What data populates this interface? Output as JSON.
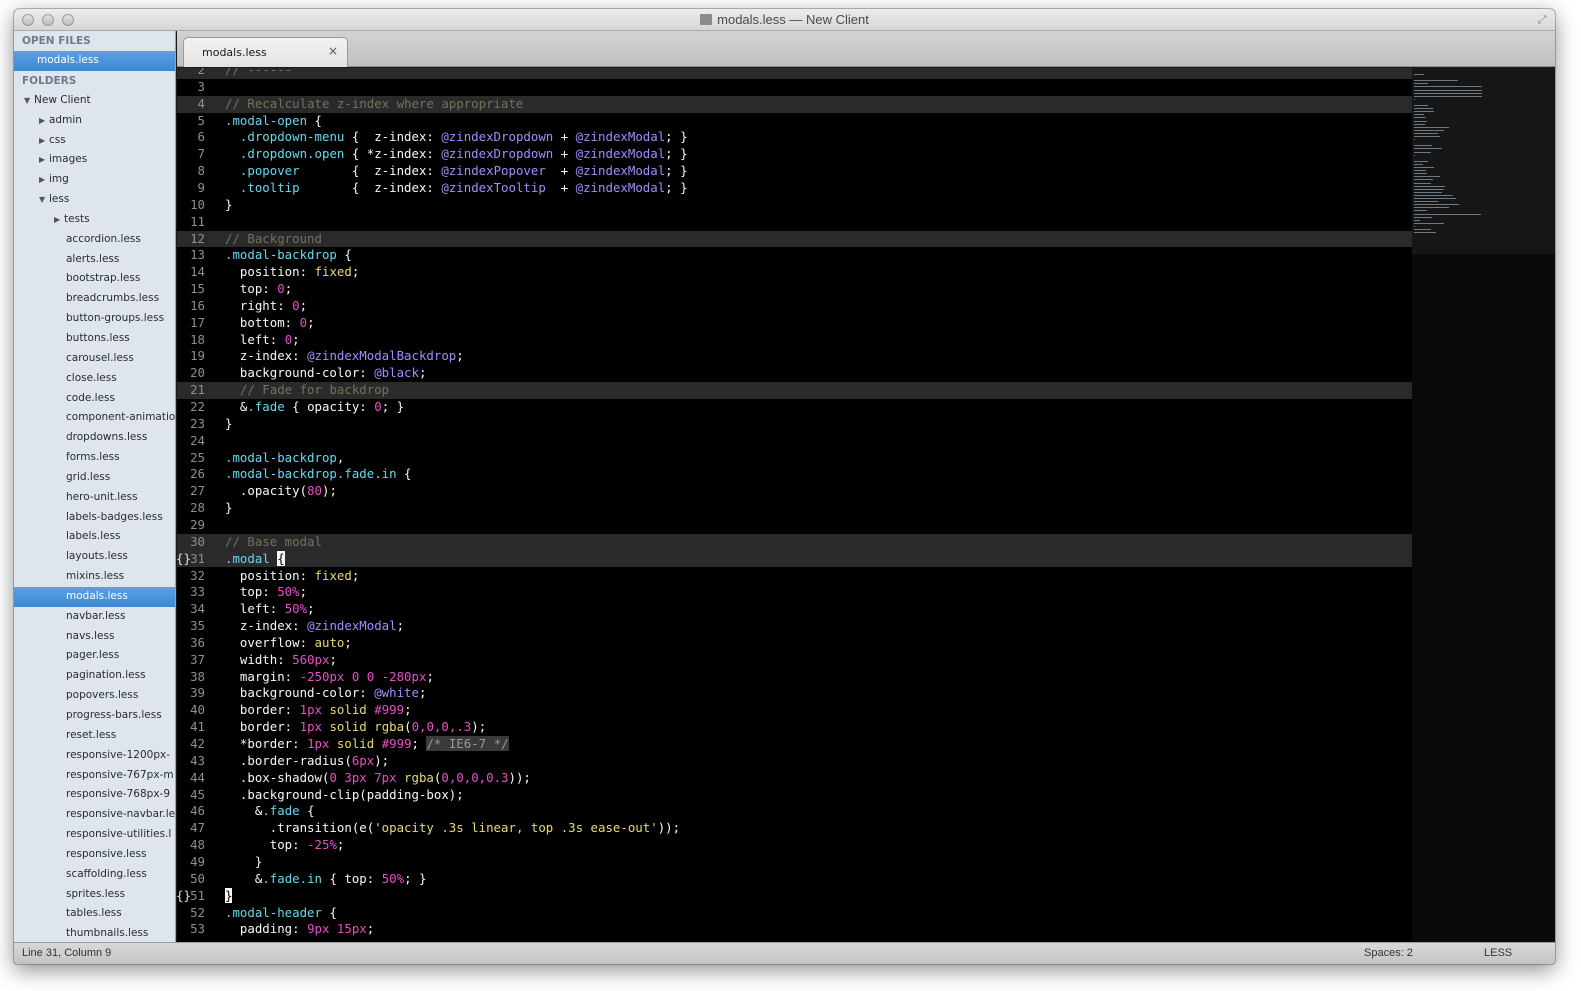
{
  "window": {
    "title": "modals.less — New Client"
  },
  "sidebar": {
    "open_files_heading": "OPEN FILES",
    "open_files": [
      "modals.less"
    ],
    "folders_heading": "FOLDERS",
    "items": [
      {
        "label": "New Client",
        "depth": 0,
        "arrow": "▼"
      },
      {
        "label": "admin",
        "depth": 1,
        "arrow": "▶"
      },
      {
        "label": "css",
        "depth": 1,
        "arrow": "▶"
      },
      {
        "label": "images",
        "depth": 1,
        "arrow": "▶"
      },
      {
        "label": "img",
        "depth": 1,
        "arrow": "▶"
      },
      {
        "label": "less",
        "depth": 1,
        "arrow": "▼"
      },
      {
        "label": "tests",
        "depth": 2,
        "arrow": "▶"
      },
      {
        "label": "accordion.less",
        "depth": 3
      },
      {
        "label": "alerts.less",
        "depth": 3
      },
      {
        "label": "bootstrap.less",
        "depth": 3
      },
      {
        "label": "breadcrumbs.less",
        "depth": 3
      },
      {
        "label": "button-groups.less",
        "depth": 3
      },
      {
        "label": "buttons.less",
        "depth": 3
      },
      {
        "label": "carousel.less",
        "depth": 3
      },
      {
        "label": "close.less",
        "depth": 3
      },
      {
        "label": "code.less",
        "depth": 3
      },
      {
        "label": "component-animatio",
        "depth": 3
      },
      {
        "label": "dropdowns.less",
        "depth": 3
      },
      {
        "label": "forms.less",
        "depth": 3
      },
      {
        "label": "grid.less",
        "depth": 3
      },
      {
        "label": "hero-unit.less",
        "depth": 3
      },
      {
        "label": "labels-badges.less",
        "depth": 3
      },
      {
        "label": "labels.less",
        "depth": 3
      },
      {
        "label": "layouts.less",
        "depth": 3
      },
      {
        "label": "mixins.less",
        "depth": 3
      },
      {
        "label": "modals.less",
        "depth": 3,
        "selected": true
      },
      {
        "label": "navbar.less",
        "depth": 3
      },
      {
        "label": "navs.less",
        "depth": 3
      },
      {
        "label": "pager.less",
        "depth": 3
      },
      {
        "label": "pagination.less",
        "depth": 3
      },
      {
        "label": "popovers.less",
        "depth": 3
      },
      {
        "label": "progress-bars.less",
        "depth": 3
      },
      {
        "label": "reset.less",
        "depth": 3
      },
      {
        "label": "responsive-1200px-",
        "depth": 3
      },
      {
        "label": "responsive-767px-m",
        "depth": 3
      },
      {
        "label": "responsive-768px-9",
        "depth": 3
      },
      {
        "label": "responsive-navbar.le",
        "depth": 3
      },
      {
        "label": "responsive-utilities.l",
        "depth": 3
      },
      {
        "label": "responsive.less",
        "depth": 3
      },
      {
        "label": "scaffolding.less",
        "depth": 3
      },
      {
        "label": "sprites.less",
        "depth": 3
      },
      {
        "label": "tables.less",
        "depth": 3
      },
      {
        "label": "thumbnails.less",
        "depth": 3
      }
    ]
  },
  "tab": {
    "label": "modals.less",
    "close": "×"
  },
  "editor": {
    "lines": [
      {
        "n": "2",
        "hl": true,
        "t": [
          [
            "cm",
            "// ------"
          ]
        ]
      },
      {
        "n": "3",
        "t": []
      },
      {
        "n": "4",
        "hl": true,
        "t": [
          [
            "cm",
            "// Recalculate z-index where appropriate"
          ]
        ]
      },
      {
        "n": "5",
        "t": [
          [
            "kw",
            ".modal-open"
          ],
          [
            "",
            " {"
          ]
        ]
      },
      {
        "n": "6",
        "t": [
          [
            "",
            "  "
          ],
          [
            "kw",
            ".dropdown-menu"
          ],
          [
            "",
            " {  z-index: "
          ],
          [
            "vr",
            "@zindexDropdown"
          ],
          [
            "",
            " + "
          ],
          [
            "vr",
            "@zindexModal"
          ],
          [
            "",
            "; }"
          ]
        ]
      },
      {
        "n": "7",
        "t": [
          [
            "",
            "  "
          ],
          [
            "kw",
            ".dropdown.open"
          ],
          [
            "",
            " { *z-index: "
          ],
          [
            "vr",
            "@zindexDropdown"
          ],
          [
            "",
            " + "
          ],
          [
            "vr",
            "@zindexModal"
          ],
          [
            "",
            "; }"
          ]
        ]
      },
      {
        "n": "8",
        "t": [
          [
            "",
            "  "
          ],
          [
            "kw",
            ".popover"
          ],
          [
            "",
            "       {  z-index: "
          ],
          [
            "vr",
            "@zindexPopover"
          ],
          [
            "",
            "  + "
          ],
          [
            "vr",
            "@zindexModal"
          ],
          [
            "",
            "; }"
          ]
        ]
      },
      {
        "n": "9",
        "t": [
          [
            "",
            "  "
          ],
          [
            "kw",
            ".tooltip"
          ],
          [
            "",
            "       {  z-index: "
          ],
          [
            "vr",
            "@zindexTooltip"
          ],
          [
            "",
            "  + "
          ],
          [
            "vr",
            "@zindexModal"
          ],
          [
            "",
            "; }"
          ]
        ]
      },
      {
        "n": "10",
        "t": [
          [
            "",
            "}"
          ]
        ]
      },
      {
        "n": "11",
        "t": []
      },
      {
        "n": "12",
        "hl": true,
        "t": [
          [
            "cm",
            "// Background"
          ]
        ]
      },
      {
        "n": "13",
        "t": [
          [
            "kw",
            ".modal-backdrop"
          ],
          [
            "",
            " {"
          ]
        ]
      },
      {
        "n": "14",
        "t": [
          [
            "",
            "  position: "
          ],
          [
            "str",
            "fixed"
          ],
          [
            "",
            ";"
          ]
        ]
      },
      {
        "n": "15",
        "t": [
          [
            "",
            "  top: "
          ],
          [
            "num",
            "0"
          ],
          [
            "",
            ";"
          ]
        ]
      },
      {
        "n": "16",
        "t": [
          [
            "",
            "  right: "
          ],
          [
            "num",
            "0"
          ],
          [
            "",
            ";"
          ]
        ]
      },
      {
        "n": "17",
        "t": [
          [
            "",
            "  bottom: "
          ],
          [
            "num",
            "0"
          ],
          [
            "",
            ";"
          ]
        ]
      },
      {
        "n": "18",
        "t": [
          [
            "",
            "  left: "
          ],
          [
            "num",
            "0"
          ],
          [
            "",
            ";"
          ]
        ]
      },
      {
        "n": "19",
        "t": [
          [
            "",
            "  z-index: "
          ],
          [
            "vr",
            "@zindexModalBackdrop"
          ],
          [
            "",
            ";"
          ]
        ]
      },
      {
        "n": "20",
        "t": [
          [
            "",
            "  background-color: "
          ],
          [
            "vr",
            "@black"
          ],
          [
            "",
            ";"
          ]
        ]
      },
      {
        "n": "21",
        "hl": true,
        "t": [
          [
            "",
            "  "
          ],
          [
            "cm",
            "// Fade for backdrop"
          ]
        ]
      },
      {
        "n": "22",
        "t": [
          [
            "",
            "  &"
          ],
          [
            "kw",
            ".fade"
          ],
          [
            "",
            " { opacity: "
          ],
          [
            "num",
            "0"
          ],
          [
            "",
            "; }"
          ]
        ]
      },
      {
        "n": "23",
        "t": [
          [
            "",
            "}"
          ]
        ]
      },
      {
        "n": "24",
        "t": []
      },
      {
        "n": "25",
        "t": [
          [
            "kw",
            ".modal-backdrop"
          ],
          [
            "",
            ","
          ]
        ]
      },
      {
        "n": "26",
        "t": [
          [
            "kw",
            ".modal-backdrop.fade.in"
          ],
          [
            "",
            " {"
          ]
        ]
      },
      {
        "n": "27",
        "t": [
          [
            "",
            "  .opacity("
          ],
          [
            "num",
            "80"
          ],
          [
            "",
            ");"
          ]
        ]
      },
      {
        "n": "28",
        "t": [
          [
            "",
            "}"
          ]
        ]
      },
      {
        "n": "29",
        "t": []
      },
      {
        "n": "30",
        "hl": true,
        "t": [
          [
            "cm",
            "// Base modal"
          ]
        ]
      },
      {
        "n": "31",
        "hl": true,
        "fold": "{}",
        "t": [
          [
            "kw",
            ".modal"
          ],
          [
            "",
            " "
          ],
          [
            "cursorbr",
            "{"
          ]
        ]
      },
      {
        "n": "32",
        "t": [
          [
            "",
            "  position: "
          ],
          [
            "str",
            "fixed"
          ],
          [
            "",
            ";"
          ]
        ]
      },
      {
        "n": "33",
        "t": [
          [
            "",
            "  top: "
          ],
          [
            "num",
            "50%"
          ],
          [
            "",
            ";"
          ]
        ]
      },
      {
        "n": "34",
        "t": [
          [
            "",
            "  left: "
          ],
          [
            "num",
            "50%"
          ],
          [
            "",
            ";"
          ]
        ]
      },
      {
        "n": "35",
        "t": [
          [
            "",
            "  z-index: "
          ],
          [
            "vr",
            "@zindexModal"
          ],
          [
            "",
            ";"
          ]
        ]
      },
      {
        "n": "36",
        "t": [
          [
            "",
            "  overflow: "
          ],
          [
            "str",
            "auto"
          ],
          [
            "",
            ";"
          ]
        ]
      },
      {
        "n": "37",
        "t": [
          [
            "",
            "  width: "
          ],
          [
            "num",
            "560px"
          ],
          [
            "",
            ";"
          ]
        ]
      },
      {
        "n": "38",
        "t": [
          [
            "",
            "  margin: "
          ],
          [
            "num",
            "-250px 0 0 -280px"
          ],
          [
            "",
            ";"
          ]
        ]
      },
      {
        "n": "39",
        "t": [
          [
            "",
            "  background-color: "
          ],
          [
            "vr",
            "@white"
          ],
          [
            "",
            ";"
          ]
        ]
      },
      {
        "n": "40",
        "t": [
          [
            "",
            "  border: "
          ],
          [
            "num",
            "1px"
          ],
          [
            "",
            " "
          ],
          [
            "str",
            "solid"
          ],
          [
            "",
            " "
          ],
          [
            "num",
            "#999"
          ],
          [
            "",
            ";"
          ]
        ]
      },
      {
        "n": "41",
        "t": [
          [
            "",
            "  border: "
          ],
          [
            "num",
            "1px"
          ],
          [
            "",
            " "
          ],
          [
            "str",
            "solid"
          ],
          [
            "",
            " "
          ],
          [
            "str",
            "rgba"
          ],
          [
            "",
            "("
          ],
          [
            "num",
            "0,0,0,.3"
          ],
          [
            "",
            ");"
          ]
        ]
      },
      {
        "n": "42",
        "t": [
          [
            "",
            "  *border: "
          ],
          [
            "num",
            "1px"
          ],
          [
            "",
            " "
          ],
          [
            "str",
            "solid"
          ],
          [
            "",
            " "
          ],
          [
            "num",
            "#999"
          ],
          [
            "",
            "; "
          ],
          [
            "cm-box",
            "/* IE6-7 */"
          ]
        ]
      },
      {
        "n": "43",
        "t": [
          [
            "",
            "  .border-radius("
          ],
          [
            "num",
            "6px"
          ],
          [
            "",
            ");"
          ]
        ]
      },
      {
        "n": "44",
        "t": [
          [
            "",
            "  .box-shadow("
          ],
          [
            "num",
            "0 3px 7px"
          ],
          [
            "",
            " "
          ],
          [
            "str",
            "rgba"
          ],
          [
            "",
            "("
          ],
          [
            "num",
            "0,0,0,0.3"
          ],
          [
            "",
            "));"
          ]
        ]
      },
      {
        "n": "45",
        "t": [
          [
            "",
            "  .background-clip(padding-box);"
          ]
        ]
      },
      {
        "n": "46",
        "t": [
          [
            "",
            "    &"
          ],
          [
            "kw",
            ".fade"
          ],
          [
            "",
            " {"
          ]
        ]
      },
      {
        "n": "47",
        "t": [
          [
            "",
            "      .transition(e("
          ],
          [
            "str",
            "'opacity .3s linear, top .3s ease-out'"
          ],
          [
            "",
            "));"
          ]
        ]
      },
      {
        "n": "48",
        "t": [
          [
            "",
            "      top: "
          ],
          [
            "num",
            "-25%"
          ],
          [
            "",
            ";"
          ]
        ]
      },
      {
        "n": "49",
        "t": [
          [
            "",
            "    }"
          ]
        ]
      },
      {
        "n": "50",
        "t": [
          [
            "",
            "    &"
          ],
          [
            "kw",
            ".fade.in"
          ],
          [
            "",
            " { top: "
          ],
          [
            "num",
            "50%"
          ],
          [
            "",
            "; }"
          ]
        ]
      },
      {
        "n": "51",
        "fold": "{}",
        "t": [
          [
            "cursorbr",
            "}"
          ]
        ]
      },
      {
        "n": "52",
        "t": [
          [
            "kw",
            ".modal-header"
          ],
          [
            "",
            " {"
          ]
        ]
      },
      {
        "n": "53",
        "t": [
          [
            "",
            "  padding: "
          ],
          [
            "num",
            "9px 15px"
          ],
          [
            "",
            ";"
          ]
        ]
      }
    ]
  },
  "status": {
    "position": "Line 31, Column 9",
    "spaces": "Spaces: 2",
    "syntax": "LESS"
  }
}
